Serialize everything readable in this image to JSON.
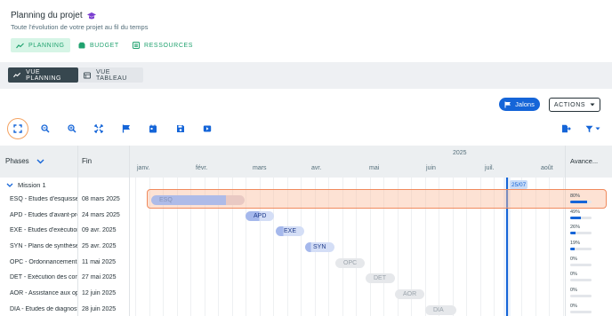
{
  "header": {
    "title": "Planning du projet",
    "subtitle": "Toute l'évolution de votre projet au fil du temps",
    "tabs": [
      {
        "label": "PLANNING",
        "icon": "trend-icon"
      },
      {
        "label": "BUDGET",
        "icon": "wallet-icon"
      },
      {
        "label": "RESSOURCES",
        "icon": "list-icon"
      }
    ],
    "accent_color": "#20a26f",
    "title_icon_color": "#7b3fd1"
  },
  "views": {
    "planning_label": "VUE PLANNING",
    "table_label": "VUE TABLEAU"
  },
  "toolbar": {
    "jalons_label": "Jalons",
    "actions_label": "ACTIONS"
  },
  "grid": {
    "phases_header": "Phases",
    "fin_header": "Fin",
    "avancement_header": "Avance...",
    "year": "2025",
    "months": [
      "janv.",
      "févr.",
      "mars",
      "avr.",
      "mai",
      "juin",
      "juil.",
      "août"
    ],
    "today_label": "25/07",
    "group_label": "Mission 1"
  },
  "rows": [
    {
      "label": "ESQ - Études d'esquisse",
      "end": "08 mars 2025",
      "code": "ESQ",
      "progress": 80,
      "progress_label": "80%"
    },
    {
      "label": "APD - Études d'avant-projet",
      "end": "24 mars 2025",
      "code": "APD",
      "progress": 49,
      "progress_label": "49%"
    },
    {
      "label": "EXE - Études d'exécution",
      "end": "09 avr. 2025",
      "code": "EXE",
      "progress": 26,
      "progress_label": "26%"
    },
    {
      "label": "SYN - Plans de synthèse",
      "end": "25 avr. 2025",
      "code": "SYN",
      "progress": 19,
      "progress_label": "19%"
    },
    {
      "label": "OPC - Ordonnancement",
      "end": "11 mai 2025",
      "code": "OPC",
      "progress": 0,
      "progress_label": "0%"
    },
    {
      "label": "DET - Exécution des contrats",
      "end": "27 mai 2025",
      "code": "DET",
      "progress": 0,
      "progress_label": "0%"
    },
    {
      "label": "AOR - Assistance aux opérations",
      "end": "12 juin 2025",
      "code": "AOR",
      "progress": 0,
      "progress_label": "0%"
    },
    {
      "label": "DIA - Études de diagnostic",
      "end": "28 juin 2025",
      "code": "DIA",
      "progress": 0,
      "progress_label": "0%"
    }
  ]
}
